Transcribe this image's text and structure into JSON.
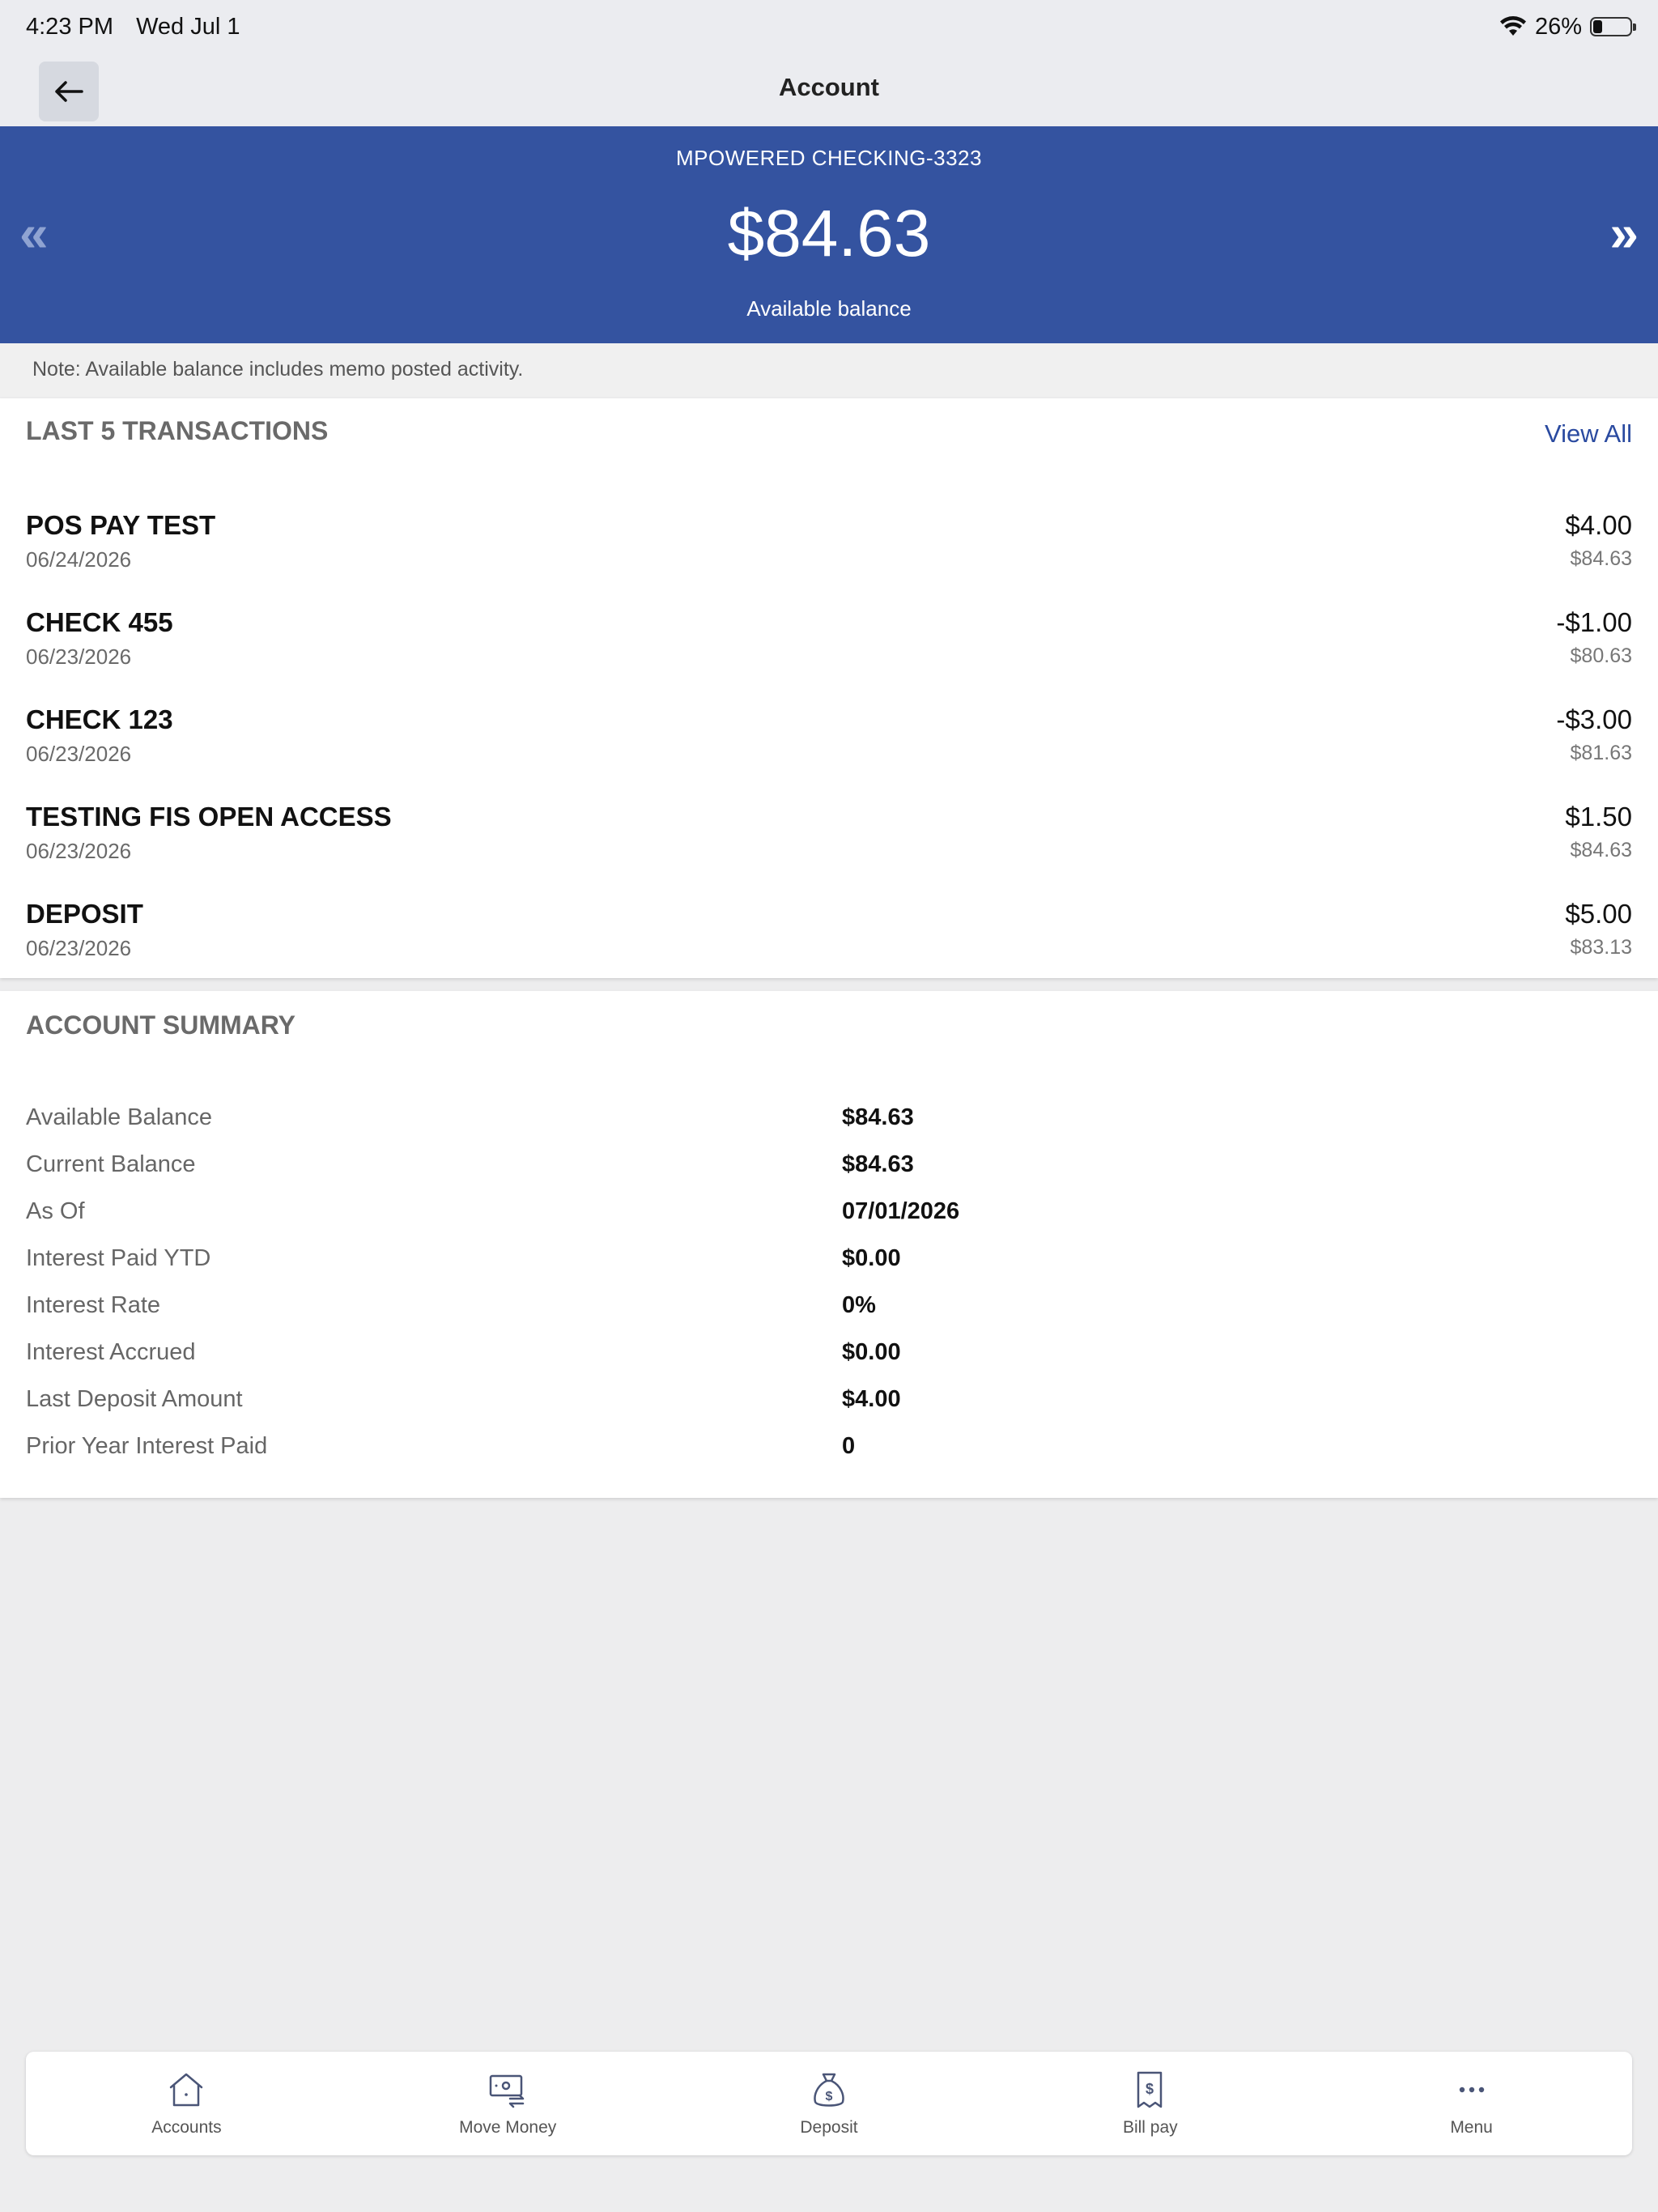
{
  "status_bar": {
    "time": "4:23 PM",
    "date": "Wed Jul 1",
    "battery": "26%"
  },
  "nav": {
    "title": "Account"
  },
  "banner": {
    "account_name": "MPOWERED CHECKING-3323",
    "balance": "$84.63",
    "balance_label": "Available balance",
    "prev_symbol": "«",
    "next_symbol": "»"
  },
  "note": "Note: Available balance includes memo posted activity.",
  "transactions": {
    "title": "LAST 5 TRANSACTIONS",
    "view_all": "View All",
    "items": [
      {
        "name": "POS PAY TEST",
        "date": "06/24/2026",
        "amount": "$4.00",
        "balance": "$84.63"
      },
      {
        "name": "CHECK 455",
        "date": "06/23/2026",
        "amount": "-$1.00",
        "balance": "$80.63"
      },
      {
        "name": "CHECK 123",
        "date": "06/23/2026",
        "amount": "-$3.00",
        "balance": "$81.63"
      },
      {
        "name": "TESTING FIS OPEN ACCESS",
        "date": "06/23/2026",
        "amount": "$1.50",
        "balance": "$84.63"
      },
      {
        "name": "DEPOSIT",
        "date": "06/23/2026",
        "amount": "$5.00",
        "balance": "$83.13"
      }
    ]
  },
  "summary": {
    "title": "ACCOUNT SUMMARY",
    "rows": [
      {
        "label": "Available Balance",
        "value": "$84.63"
      },
      {
        "label": "Current Balance",
        "value": "$84.63"
      },
      {
        "label": "As Of",
        "value": "07/01/2026"
      },
      {
        "label": "Interest Paid YTD",
        "value": "$0.00"
      },
      {
        "label": "Interest Rate",
        "value": "0%"
      },
      {
        "label": "Interest Accrued",
        "value": "$0.00"
      },
      {
        "label": "Last Deposit Amount",
        "value": "$4.00"
      },
      {
        "label": "Prior Year Interest Paid",
        "value": "0"
      }
    ]
  },
  "tabbar": {
    "items": [
      {
        "label": "Accounts",
        "icon": "house-icon"
      },
      {
        "label": "Move Money",
        "icon": "money-transfer-icon"
      },
      {
        "label": "Deposit",
        "icon": "money-bag-icon"
      },
      {
        "label": "Bill pay",
        "icon": "bill-icon"
      },
      {
        "label": "Menu",
        "icon": "more-dots-icon"
      }
    ]
  },
  "colors": {
    "banner": "#3453a0",
    "link": "#2a4aa0",
    "icon": "#4a5577"
  }
}
